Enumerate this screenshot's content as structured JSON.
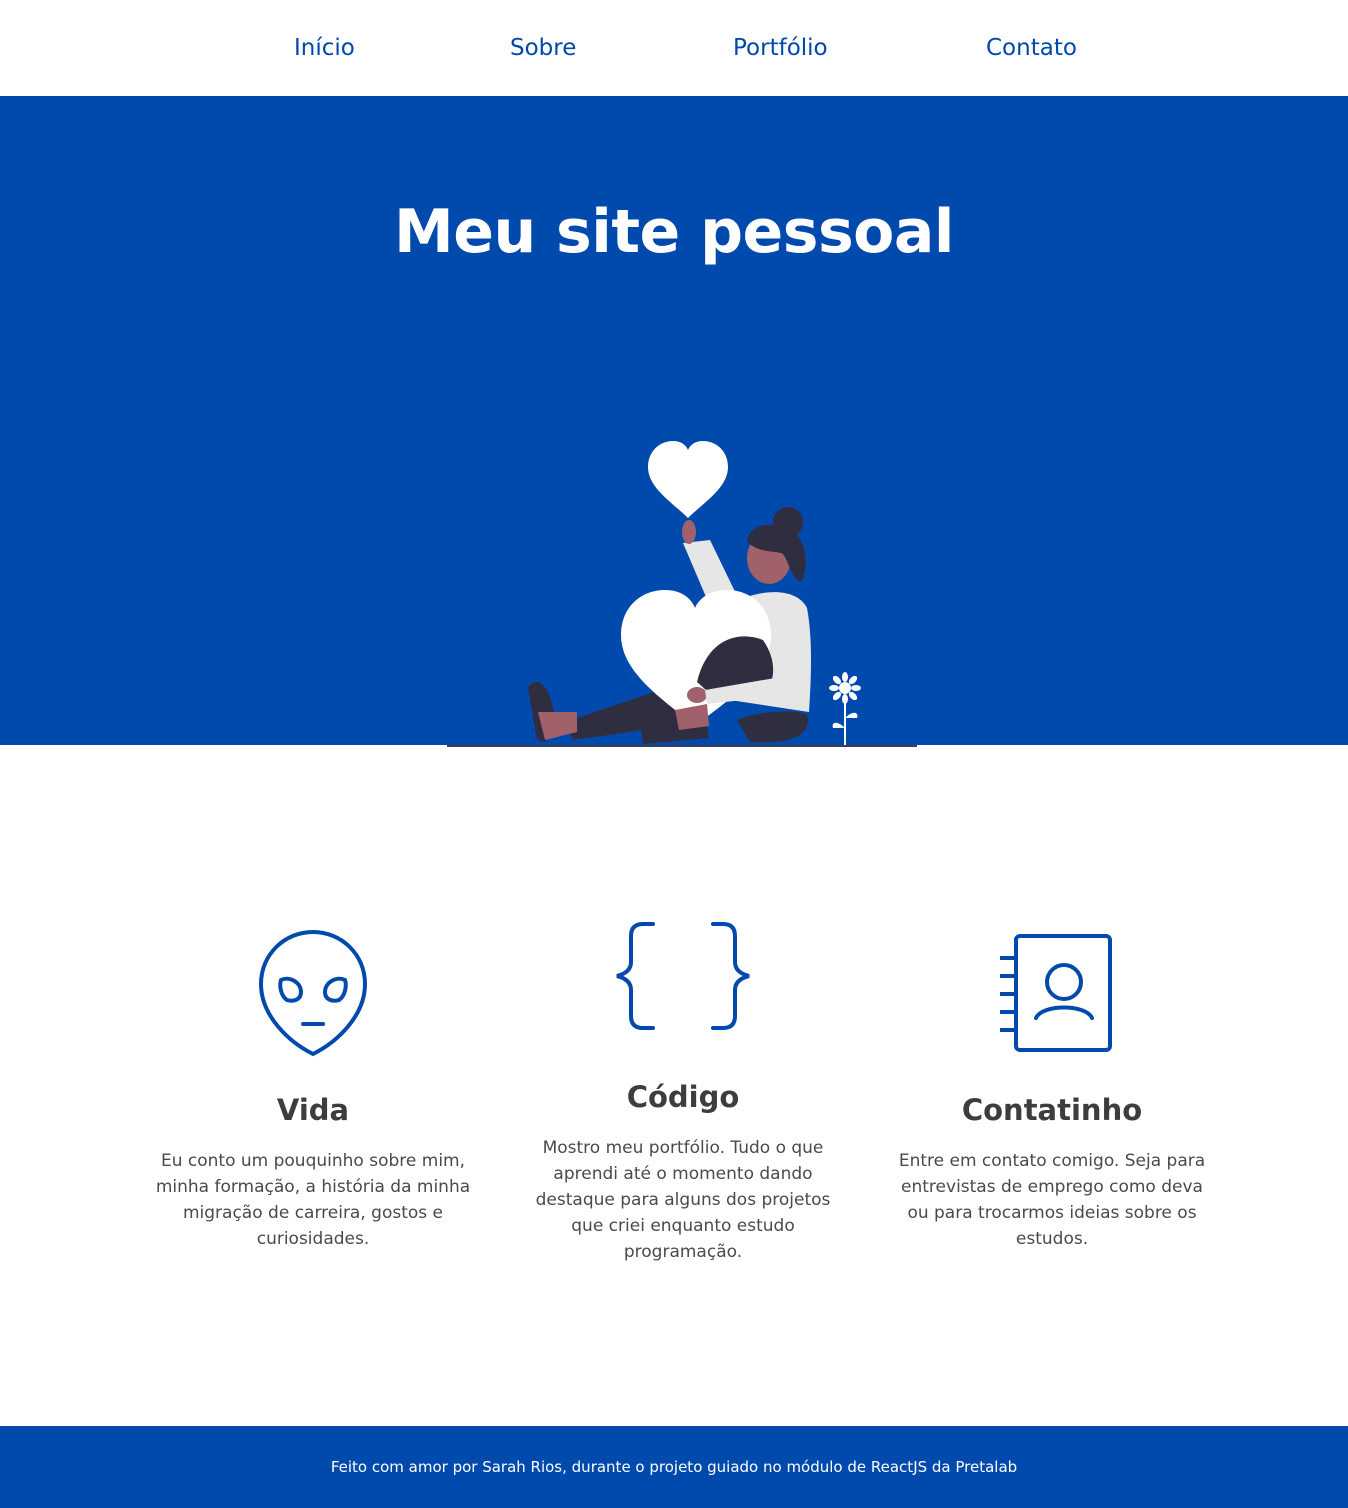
{
  "nav": {
    "items": [
      {
        "label": "Início"
      },
      {
        "label": "Sobre"
      },
      {
        "label": "Portfólio"
      },
      {
        "label": "Contato"
      }
    ]
  },
  "hero": {
    "title": "Meu site pessoal",
    "illustration": "woman-hugging-heart-illustration"
  },
  "features": [
    {
      "icon": "alien-icon",
      "title": "Vida",
      "text": "Eu conto um pouquinho sobre mim, minha formação, a história da minha migração de carreira, gostos e curiosidades."
    },
    {
      "icon": "curly-braces-icon",
      "title": "Código",
      "text": "Mostro meu portfólio. Tudo o que aprendi até o momento dando destaque para alguns dos projetos que criei enquanto estudo programação."
    },
    {
      "icon": "address-book-icon",
      "title": "Contatinho",
      "text": "Entre em contato comigo. Seja para entrevistas de emprego como deva ou para trocarmos ideias sobre os estudos."
    }
  ],
  "footer": {
    "text": "Feito com amor por Sarah Rios, durante o projeto guiado no módulo de ReactJS da Pretalab"
  },
  "colors": {
    "brand_blue": "#004aad",
    "text_dark": "#3d3d3d",
    "white": "#ffffff"
  }
}
